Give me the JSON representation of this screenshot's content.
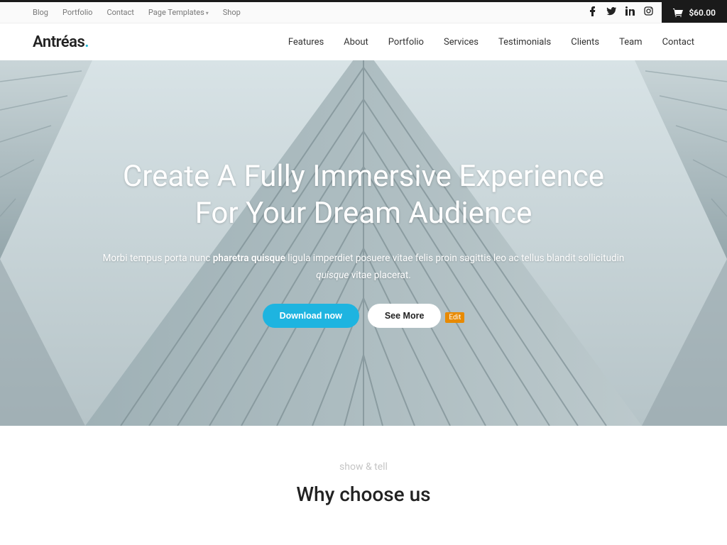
{
  "utilNav": {
    "items": [
      "Blog",
      "Portfolio",
      "Contact",
      "Page Templates",
      "Shop"
    ]
  },
  "socialIcons": [
    "facebook",
    "twitter",
    "linkedin",
    "instagram"
  ],
  "cart": {
    "amount": "$60.00"
  },
  "logo": {
    "text": "Antréas",
    "dot": "."
  },
  "mainNav": {
    "items": [
      "Features",
      "About",
      "Portfolio",
      "Services",
      "Testimonials",
      "Clients",
      "Team",
      "Contact"
    ]
  },
  "hero": {
    "headline": "Create A Fully Immersive Experience For Your Dream Audience",
    "sub_pre": "Morbi tempus porta nunc ",
    "sub_strong": "pharetra quisque",
    "sub_mid": " ligula imperdiet posuere vitae felis proin sagittis leo ac tellus blandit sollicitudin ",
    "sub_em": "quisque",
    "sub_post": " vitae placerat.",
    "btnPrimary": "Download now",
    "btnSecondary": "See More",
    "editLabel": "Edit"
  },
  "section": {
    "eyebrow": "show & tell",
    "title": "Why choose us"
  }
}
